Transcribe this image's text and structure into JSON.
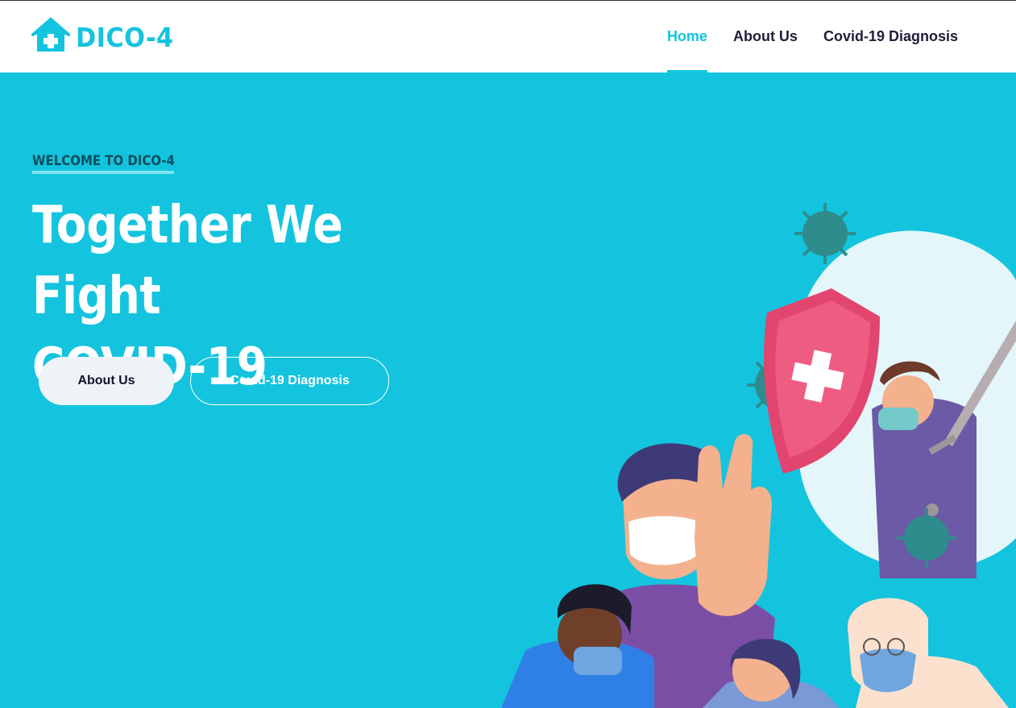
{
  "brand": {
    "name": "DICO-4",
    "icon": "house-medical-icon",
    "color": "#14c4de"
  },
  "nav": {
    "items": [
      {
        "label": "Home",
        "active": true
      },
      {
        "label": "About Us",
        "active": false
      },
      {
        "label": "Covid-19 Diagnosis",
        "active": false
      }
    ]
  },
  "hero": {
    "eyebrow": "WELCOME TO DICO-4",
    "title_line1": "Together We Fight",
    "title_line2": "COVID-19",
    "buttons": {
      "about": "About Us",
      "diagnosis": "Covid-19 Diagnosis"
    },
    "background": "#14c4de"
  }
}
